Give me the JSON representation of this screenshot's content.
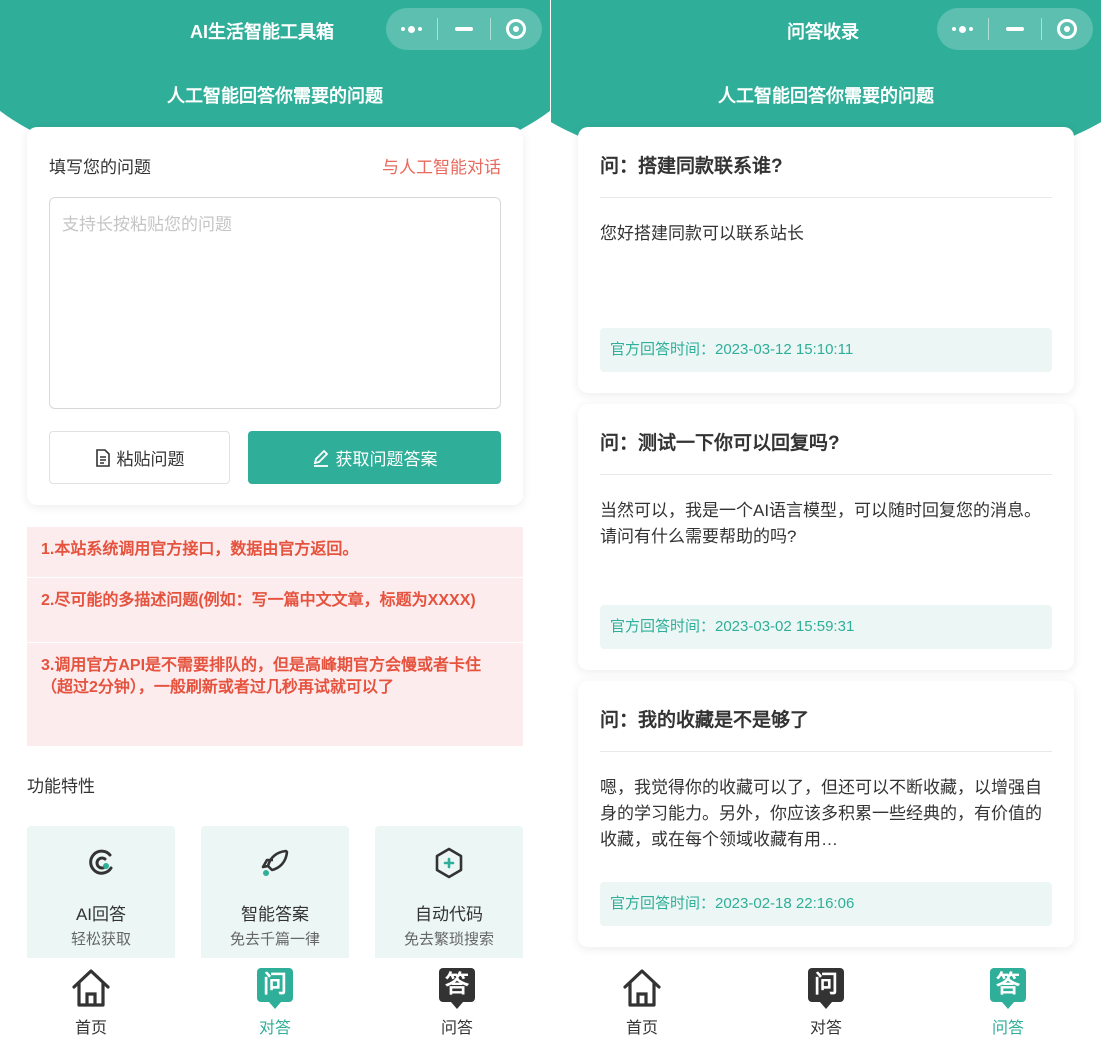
{
  "colors": {
    "accent": "#2fae99",
    "warning_bg": "#fdeced",
    "warning_text": "#e5533f",
    "link": "#e96a5e"
  },
  "left": {
    "nav_title": "AI生活智能工具箱",
    "subtitle": "人工智能回答你需要的问题",
    "ask": {
      "label": "填写您的问题",
      "ai_link": "与人工智能对话",
      "placeholder": "支持长按粘贴您的问题",
      "paste_label": "粘贴问题",
      "submit_label": "获取问题答案"
    },
    "notices": [
      "1.本站系统调用官方接口，数据由官方返回。",
      "2.尽可能的多描述问题(例如：写一篇中文文章，标题为XXXX)",
      "3.调用官方API是不需要排队的，但是高峰期官方会慢或者卡住（超过2分钟），一般刷新或者过几秒再试就可以了"
    ],
    "features_title": "功能特性",
    "features": [
      {
        "name": "AI回答",
        "desc": "轻松获取",
        "icon": "ai-swirl-icon"
      },
      {
        "name": "智能答案",
        "desc": "免去千篇一律",
        "icon": "rocket-icon"
      },
      {
        "name": "自动代码",
        "desc": "免去繁琐搜索",
        "icon": "hexagon-plus-icon"
      }
    ],
    "tabs": [
      {
        "label": "首页",
        "icon": "home-icon"
      },
      {
        "label": "对答",
        "glyph": "问",
        "icon": "chat-bubble-icon"
      },
      {
        "label": "问答",
        "glyph": "答",
        "icon": "answer-bubble-icon"
      }
    ]
  },
  "right": {
    "nav_title": "问答收录",
    "subtitle": "人工智能回答你需要的问题",
    "items": [
      {
        "question": "问：搭建同款联系谁?",
        "answer": "您好搭建同款可以联系站长",
        "time": "官方回答时间：2023-03-12 15:10:11"
      },
      {
        "question": "问：测试一下你可以回复吗?",
        "answer": "当然可以，我是一个AI语言模型，可以随时回复您的消息。请问有什么需要帮助的吗?",
        "time": "官方回答时间：2023-03-02 15:59:31"
      },
      {
        "question": "问：我的收藏是不是够了",
        "answer": "嗯，我觉得你的收藏可以了，但还可以不断收藏，以增强自身的学习能力。另外，你应该多积累一些经典的，有价值的收藏，或在每个领域收藏有用…",
        "time": "官方回答时间：2023-02-18 22:16:06"
      }
    ],
    "tabs": [
      {
        "label": "首页",
        "icon": "home-icon"
      },
      {
        "label": "对答",
        "glyph": "问",
        "icon": "chat-bubble-icon"
      },
      {
        "label": "问答",
        "glyph": "答",
        "icon": "answer-bubble-icon"
      }
    ]
  }
}
